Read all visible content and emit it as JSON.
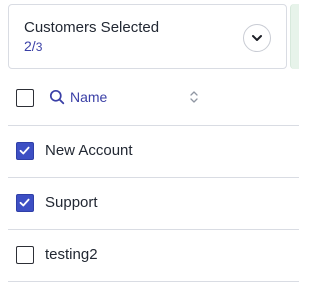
{
  "selector": {
    "title": "Customers Selected",
    "selected_count": "2",
    "separator": "/",
    "total_count": "3"
  },
  "table": {
    "column_header": "Name",
    "rows": [
      {
        "name": "New Account",
        "checked": true
      },
      {
        "name": "Support",
        "checked": true
      },
      {
        "name": "testing2",
        "checked": false
      }
    ]
  },
  "colors": {
    "accent": "#3d4fc4",
    "link": "#3a3fa6",
    "border": "#d9dce3",
    "side_panel": "#e7f3ea"
  },
  "icons": {
    "toggle": "chevron-down-icon",
    "search": "search-icon",
    "sort": "sort-icon",
    "check": "check-icon"
  }
}
